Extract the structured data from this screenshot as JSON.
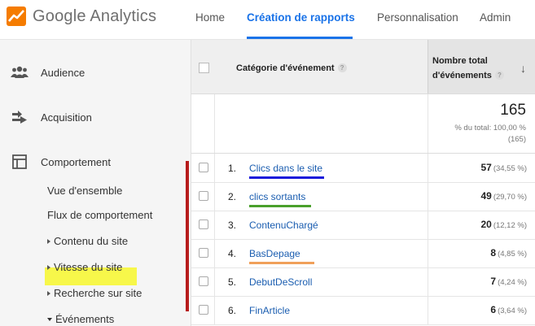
{
  "app": {
    "logo_text": "Google Analytics",
    "nav": [
      "Home",
      "Création de rapports",
      "Personnalisation",
      "Admin"
    ],
    "active_nav": "Création de rapports"
  },
  "sidebar": {
    "sections": [
      {
        "label": "Audience",
        "icon": "people-icon"
      },
      {
        "label": "Acquisition",
        "icon": "arrows-merge-icon"
      },
      {
        "label": "Comportement",
        "icon": "layout-icon"
      }
    ],
    "sub_items": [
      {
        "label": "Vue d'ensemble"
      },
      {
        "label": "Flux de comportement"
      },
      {
        "label": "Contenu du site",
        "expandable": true
      },
      {
        "label": "Vitesse du site",
        "expandable": true
      },
      {
        "label": "Recherche sur site",
        "expandable": true
      },
      {
        "label": "Événements",
        "expanded": true,
        "highlighted": true
      }
    ]
  },
  "table": {
    "col1_header": "Catégorie d'événement",
    "col2_header": "Nombre total d'événements",
    "help_glyph": "?",
    "sort_glyph": "↓",
    "summary": {
      "total": "165",
      "pct_line1": "% du total: 100,00 %",
      "pct_line2": "(165)"
    },
    "rows": [
      {
        "num": "1.",
        "label": "Clics dans le site",
        "value": "57",
        "pct": "(34,55 %)",
        "underline_color": "#1a1adb"
      },
      {
        "num": "2.",
        "label": "clics sortants",
        "value": "49",
        "pct": "(29,70 %)",
        "underline_color": "#4aa02c"
      },
      {
        "num": "3.",
        "label": "ContenuChargé",
        "value": "20",
        "pct": "(12,12 %)"
      },
      {
        "num": "4.",
        "label": "BasDepage",
        "value": "8",
        "pct": "(4,85 %)",
        "underline_color": "#f0a05a"
      },
      {
        "num": "5.",
        "label": "DebutDeScroll",
        "value": "7",
        "pct": "(4,24 %)"
      },
      {
        "num": "6.",
        "label": "FinArticle",
        "value": "6",
        "pct": "(3,64 %)"
      }
    ]
  },
  "colors": {
    "accent": "#1a73e8",
    "highlight": "#f7f74a",
    "annotation_bar": "#b71c1c"
  }
}
